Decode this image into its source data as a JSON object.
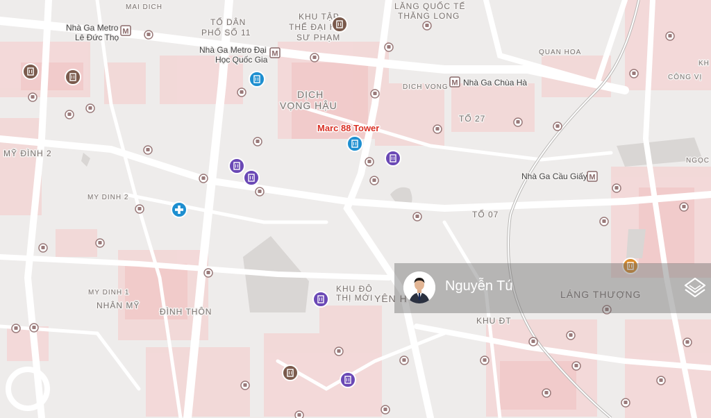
{
  "map": {
    "featured_place": "Marc 88 Tower",
    "area_labels": [
      "MỸ ĐÌNH 2",
      "MY DINH 2",
      "MY DINH 1",
      "NHÂN MỸ",
      "ĐÌNH THÔN",
      "DỊCH",
      "VỌNG HẬU",
      "DICH VONG",
      "TỔ 27",
      "TỔ 07",
      "KHU ĐÔ",
      "THỊ MỚI",
      "YÊN H",
      "KHU ĐT",
      "LÁNG THƯỢNG",
      "QUAN HOA",
      "CÔNG VỊ",
      "NGỌC KHÁN",
      "MAI DICH",
      "TỔ DÂN",
      "PHỐ SỐ 11",
      "KHU TẬP",
      "THỂ ĐẠI H",
      "SƯ PHẠM",
      "LĂNG QUỐC TẾ",
      "THĂNG LONG",
      "KH"
    ],
    "stations": [
      "Nhà Ga Metro",
      "Lê Đức Thọ",
      "Nhà Ga Metro Đại",
      "Học Quốc Gia",
      "Nhà Ga Chùa Hà",
      "Nhà Ga Cầu Giấy"
    ],
    "metro_glyph": "M"
  },
  "agent": {
    "name": "Nguyễn Tú",
    "avatar": "person-avatar-icon",
    "logo": "brand-logo-icon"
  },
  "colors": {
    "featured_red": "#d93025",
    "poi_blue": "#1e8fd0",
    "poi_purple": "#6a48b5",
    "poi_brown": "#7a5a4c",
    "poi_orange": "#d98a2a",
    "bus_stop": "#8a5c5c"
  }
}
